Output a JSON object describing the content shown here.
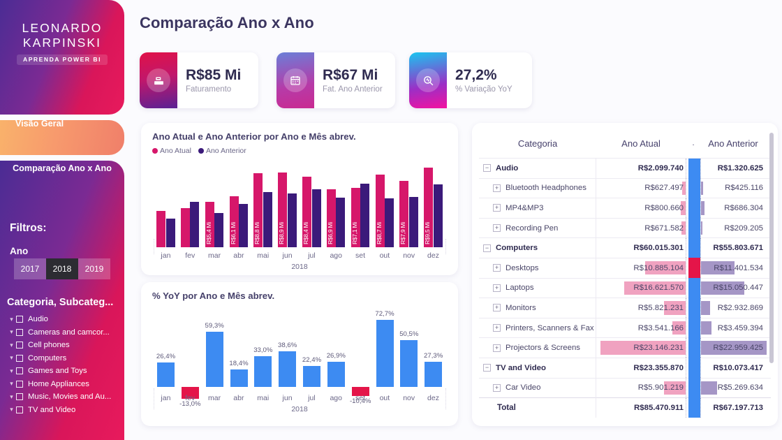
{
  "sidebar": {
    "logo": {
      "line1": "LEONARDO",
      "line2": "KARPINSKI",
      "badge": "APRENDA POWER BI"
    },
    "nav": [
      {
        "label": "Visão Geral",
        "active": false
      },
      {
        "label": "Comparação Ano x Ano",
        "active": true
      }
    ],
    "filters_title": "Filtros:",
    "year_filter": {
      "label": "Ano",
      "options": [
        "2017",
        "2018",
        "2019"
      ],
      "selected": "2018"
    },
    "category_filter": {
      "label": "Categoria, Subcateg...",
      "items": [
        "Audio",
        "Cameras and camcor...",
        "Cell phones",
        "Computers",
        "Games and Toys",
        "Home Appliances",
        "Music, Movies and Au...",
        "TV and Video"
      ]
    }
  },
  "header": {
    "title": "Comparação Ano x Ano"
  },
  "kpis": [
    {
      "value": "R$85 Mi",
      "label": "Faturamento",
      "icon": "cash-register-icon"
    },
    {
      "value": "R$67 Mi",
      "label": "Fat. Ano Anterior",
      "icon": "calendar-icon"
    },
    {
      "value": "27,2%",
      "label": "% Variação YoY",
      "icon": "magnifier-pulse-icon"
    }
  ],
  "chart_data": [
    {
      "type": "bar",
      "title": "Ano Atual e Ano Anterior por Ano e Mês abrev.",
      "xlabel": "2018",
      "ylabel": "",
      "categories": [
        "jan",
        "fev",
        "mar",
        "abr",
        "mai",
        "jun",
        "jul",
        "ago",
        "set",
        "out",
        "nov",
        "dez"
      ],
      "legend": [
        "Ano Atual",
        "Ano Anterior"
      ],
      "legend_position": "top-left",
      "colors": {
        "Ano Atual": "#d6176a",
        "Ano Anterior": "#3b1a7a"
      },
      "series": [
        {
          "name": "Ano Atual",
          "values": [
            4.3,
            4.7,
            5.4,
            6.1,
            8.8,
            8.9,
            8.4,
            6.9,
            7.1,
            8.7,
            7.9,
            9.5
          ],
          "labels": [
            "",
            "",
            "R$5,4 Mi",
            "R$6,1 Mi",
            "R$8,8 Mi",
            "R$8,9 Mi",
            "R$8,4 Mi",
            "R$6,9 Mi",
            "R$7,1 Mi",
            "R$8,7 Mi",
            "R$7,9 Mi",
            "R$9,5 Mi"
          ]
        },
        {
          "name": "Ano Anterior",
          "values": [
            3.4,
            5.4,
            4.1,
            5.2,
            6.6,
            6.4,
            6.9,
            5.9,
            7.6,
            5.8,
            6.0,
            7.5
          ],
          "labels": [
            "",
            "",
            "",
            "",
            "",
            "",
            "",
            "",
            "",
            "",
            "",
            ""
          ]
        }
      ],
      "ylim": [
        0,
        10
      ],
      "grid": false
    },
    {
      "type": "bar",
      "title": "% YoY por Ano e Mês abrev.",
      "xlabel": "2018",
      "ylabel": "",
      "categories": [
        "jan",
        "fev",
        "mar",
        "abr",
        "mai",
        "jun",
        "jul",
        "ago",
        "set",
        "out",
        "nov",
        "dez"
      ],
      "values": [
        26.4,
        -13.0,
        59.3,
        18.4,
        33.0,
        38.6,
        22.4,
        26.9,
        -10.4,
        72.7,
        50.5,
        27.3
      ],
      "labels": [
        "26,4%",
        "-13,0%",
        "59,3%",
        "18,4%",
        "33,0%",
        "38,6%",
        "22,4%",
        "26,9%",
        "-10,4%",
        "72,7%",
        "50,5%",
        "27,3%"
      ],
      "colors": {
        "positive": "#3d8bf2",
        "negative": "#e41549"
      },
      "ylim": [
        -20,
        80
      ],
      "grid": false
    }
  ],
  "table": {
    "columns": [
      "Categoria",
      "Ano Atual",
      ".",
      "Ano Anterior"
    ],
    "rows": [
      {
        "name": "Audio",
        "level": "group",
        "atual": "R$2.099.740",
        "anterior": "R$1.320.625",
        "atual_bar": 0,
        "anterior_bar": 0,
        "ind": "blue"
      },
      {
        "name": "Bluetooth Headphones",
        "level": "sub",
        "atual": "R$627.497",
        "anterior": "R$425.116",
        "atual_bar": 5,
        "anterior_bar": 3,
        "ind": "blue"
      },
      {
        "name": "MP4&MP3",
        "level": "sub",
        "atual": "R$800.660",
        "anterior": "R$686.304",
        "atual_bar": 7,
        "anterior_bar": 5,
        "ind": "blue"
      },
      {
        "name": "Recording Pen",
        "level": "sub",
        "atual": "R$671.582",
        "anterior": "R$209.205",
        "atual_bar": 6,
        "anterior_bar": 2,
        "ind": "blue"
      },
      {
        "name": "Computers",
        "level": "group",
        "atual": "R$60.015.301",
        "anterior": "R$55.803.671",
        "atual_bar": 0,
        "anterior_bar": 0,
        "ind": "blue"
      },
      {
        "name": "Desktops",
        "level": "sub",
        "atual": "R$10.885.104",
        "anterior": "R$11.401.534",
        "atual_bar": 58,
        "anterior_bar": 48,
        "ind": "red"
      },
      {
        "name": "Laptops",
        "level": "sub",
        "atual": "R$16.621.570",
        "anterior": "R$15.050.447",
        "atual_bar": 88,
        "anterior_bar": 62,
        "ind": "blue"
      },
      {
        "name": "Monitors",
        "level": "sub",
        "atual": "R$5.821.231",
        "anterior": "R$2.932.869",
        "atual_bar": 31,
        "anterior_bar": 13,
        "ind": "blue"
      },
      {
        "name": "Printers, Scanners & Fax",
        "level": "sub",
        "atual": "R$3.541.166",
        "anterior": "R$3.459.394",
        "atual_bar": 19,
        "anterior_bar": 15,
        "ind": "blue"
      },
      {
        "name": "Projectors & Screens",
        "level": "sub",
        "atual": "R$23.146.231",
        "anterior": "R$22.959.425",
        "atual_bar": 122,
        "anterior_bar": 94,
        "ind": "blue"
      },
      {
        "name": "TV and Video",
        "level": "group",
        "atual": "R$23.355.870",
        "anterior": "R$10.073.417",
        "atual_bar": 0,
        "anterior_bar": 0,
        "ind": "blue"
      },
      {
        "name": "Car Video",
        "level": "sub",
        "atual": "R$5.901.219",
        "anterior": "R$5.269.634",
        "atual_bar": 31,
        "anterior_bar": 23,
        "ind": "blue"
      },
      {
        "name": "Total",
        "level": "total",
        "atual": "R$85.470.911",
        "anterior": "R$67.197.713",
        "atual_bar": 0,
        "anterior_bar": 0,
        "ind": "blue"
      }
    ]
  },
  "colors": {
    "accent_pink": "#d6176a",
    "accent_purple": "#3b1a7a",
    "blue": "#3d8bf2",
    "red": "#e41549",
    "page_bg": "#fbfbfe"
  }
}
